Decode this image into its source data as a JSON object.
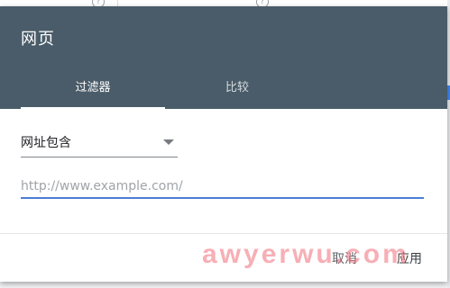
{
  "background": {
    "help_glyph": "?"
  },
  "dialog": {
    "title": "网页",
    "tabs": [
      {
        "label": "过滤器",
        "active": true
      },
      {
        "label": "比较",
        "active": false
      }
    ],
    "filter_select": {
      "value": "网址包含"
    },
    "url_input": {
      "value": "",
      "placeholder": "http://www.example.com/"
    },
    "buttons": {
      "cancel": "取消",
      "apply": "应用"
    }
  },
  "watermark": "awyerwu.com",
  "colors": {
    "header": "#4a5c69",
    "accent": "#4a7fd4",
    "watermark": "#f06e78"
  }
}
